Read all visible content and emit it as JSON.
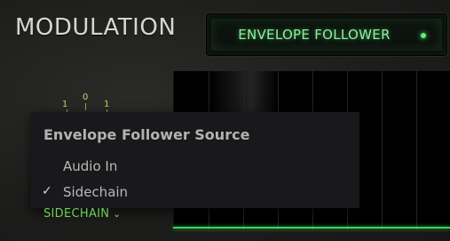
{
  "panel": {
    "title": "MODULATION"
  },
  "mode_button": {
    "label": "ENVELOPE FOLLOWER",
    "led_color": "#5cf07a"
  },
  "knob_scale": {
    "left": "1",
    "center": "0",
    "right": "1"
  },
  "source_menu": {
    "header": "Envelope Follower Source",
    "items": [
      {
        "label": "Audio In",
        "checked": false,
        "check_mark": ""
      },
      {
        "label": "Sidechain",
        "checked": true,
        "check_mark": "✓"
      }
    ]
  },
  "source_selector": {
    "value": "SIDECHAIN",
    "icon": "chevron-down-icon",
    "color": "#6fd05a"
  }
}
